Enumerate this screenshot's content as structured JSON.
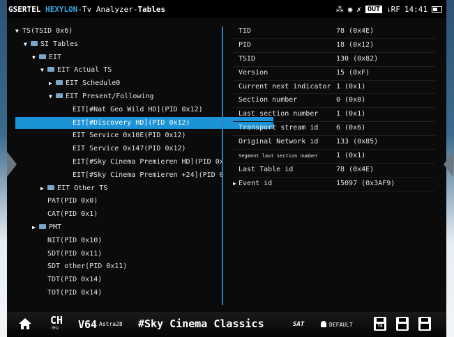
{
  "header": {
    "brand1": "GSERTEL",
    "brand2": "HEXYLON",
    "app_title": "-Tv Analyzer-",
    "page": "Tables",
    "out_label": "OUT",
    "rf_label": "⇂RF",
    "time": "14:41"
  },
  "tree": [
    {
      "label": "TS(TSID 0x6)",
      "indent": 0,
      "toggle": "open",
      "folder": false
    },
    {
      "label": "SI Tables",
      "indent": 1,
      "toggle": "open",
      "folder": true
    },
    {
      "label": "EIT",
      "indent": 2,
      "toggle": "open",
      "folder": true
    },
    {
      "label": "EIT Actual TS",
      "indent": 3,
      "toggle": "open",
      "folder": true
    },
    {
      "label": "EIT Schedule0",
      "indent": 4,
      "toggle": "closed",
      "folder": true
    },
    {
      "label": "EIT Present/Following",
      "indent": 4,
      "toggle": "open",
      "folder": true
    },
    {
      "label": "EIT[#Nat Geo Wild HD](PID 0x12)",
      "indent": 6,
      "toggle": "",
      "folder": false
    },
    {
      "label": "EIT[#Discovery HD](PID 0x12)",
      "indent": 6,
      "toggle": "",
      "folder": false,
      "selected": true
    },
    {
      "label": "EIT Service 0x10E(PID 0x12)",
      "indent": 6,
      "toggle": "",
      "folder": false
    },
    {
      "label": "EIT Service 0x147(PID 0x12)",
      "indent": 6,
      "toggle": "",
      "folder": false
    },
    {
      "label": "EIT[#Sky Cinema Premieren HD](PID 0x",
      "indent": 6,
      "toggle": "",
      "folder": false
    },
    {
      "label": "EIT[#Sky Cinema Premieren +24](PID 0",
      "indent": 6,
      "toggle": "",
      "folder": false
    },
    {
      "label": "EIT Other TS",
      "indent": 3,
      "toggle": "closed",
      "folder": true
    },
    {
      "label": "PAT(PID 0x0)",
      "indent": 3,
      "toggle": "",
      "folder": false
    },
    {
      "label": "CAT(PID 0x1)",
      "indent": 3,
      "toggle": "",
      "folder": false
    },
    {
      "label": "PMT",
      "indent": 2,
      "toggle": "closed",
      "folder": true
    },
    {
      "label": "NIT(PID 0x10)",
      "indent": 3,
      "toggle": "",
      "folder": false
    },
    {
      "label": "SDT(PID 0x11)",
      "indent": 3,
      "toggle": "",
      "folder": false
    },
    {
      "label": "SDT other(PID 0x11)",
      "indent": 3,
      "toggle": "",
      "folder": false
    },
    {
      "label": "TDT(PID 0x14)",
      "indent": 3,
      "toggle": "",
      "folder": false
    },
    {
      "label": "TOT(PID 0x14)",
      "indent": 3,
      "toggle": "",
      "folder": false
    }
  ],
  "details": [
    {
      "key": "TID",
      "value": "78 (0x4E)"
    },
    {
      "key": "PID",
      "value": "18 (0x12)"
    },
    {
      "key": "TSID",
      "value": "130 (0x82)"
    },
    {
      "key": "Version",
      "value": "15 (0xF)"
    },
    {
      "key": "Current next indicator",
      "value": "1 (0x1)"
    },
    {
      "key": "Section number",
      "value": "0 (0x0)"
    },
    {
      "key": "Last section number",
      "value": "1 (0x1)"
    },
    {
      "key": "Transport stream id",
      "value": "6 (0x6)"
    },
    {
      "key": "Original Network id",
      "value": "133 (0x85)"
    },
    {
      "key": "Segment last section number",
      "value": "1 (0x1)",
      "small": true
    },
    {
      "key": "Last Table id",
      "value": "78 (0x4E)"
    },
    {
      "key": "Event id",
      "value": "15097 (0x3AF9)",
      "expandable": true
    }
  ],
  "footer": {
    "ch_label": "CH",
    "mhz_label": "MHz",
    "channel": "V64",
    "satellite": "Astra28",
    "program": "#Sky Cinema Classics",
    "sat_logo": "SAT",
    "user": "DEFAULT",
    "ts_label": "TS"
  },
  "colors": {
    "accent": "#1c93d6",
    "brand_blue": "#3fa3e0",
    "background": "#0b0b0b"
  }
}
